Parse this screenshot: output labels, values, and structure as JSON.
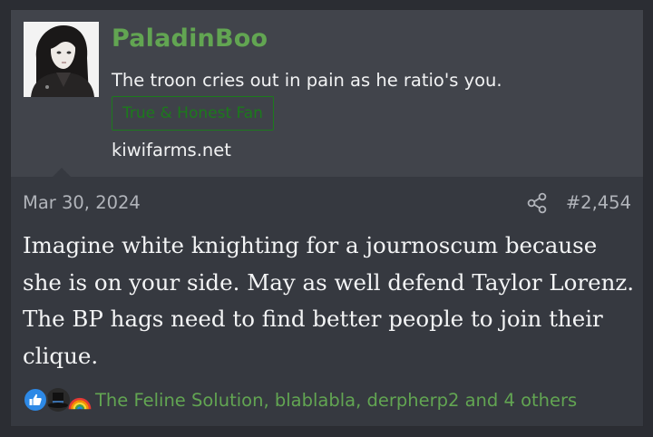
{
  "user": {
    "username": "PaladinBoo",
    "title": "The troon cries out in pain as he ratio's you.",
    "banner": "True & Honest Fan",
    "site": "kiwifarms.net"
  },
  "post": {
    "date": "Mar 30, 2024",
    "number": "#2,454",
    "message": "Imagine white knighting for a journoscum because she is on your side. May as well defend Taylor Lorenz. The BP hags need to find better people to join their clique."
  },
  "reactions": {
    "icons": [
      "thumbs-up-icon",
      "top-hat-icon",
      "rainbow-icon"
    ],
    "text": "The Feline Solution, blablabla, derpherp2 and 4 others"
  },
  "colors": {
    "accent": "#62a552",
    "banner": "#1c7a1c",
    "like": "#2d89e6"
  }
}
